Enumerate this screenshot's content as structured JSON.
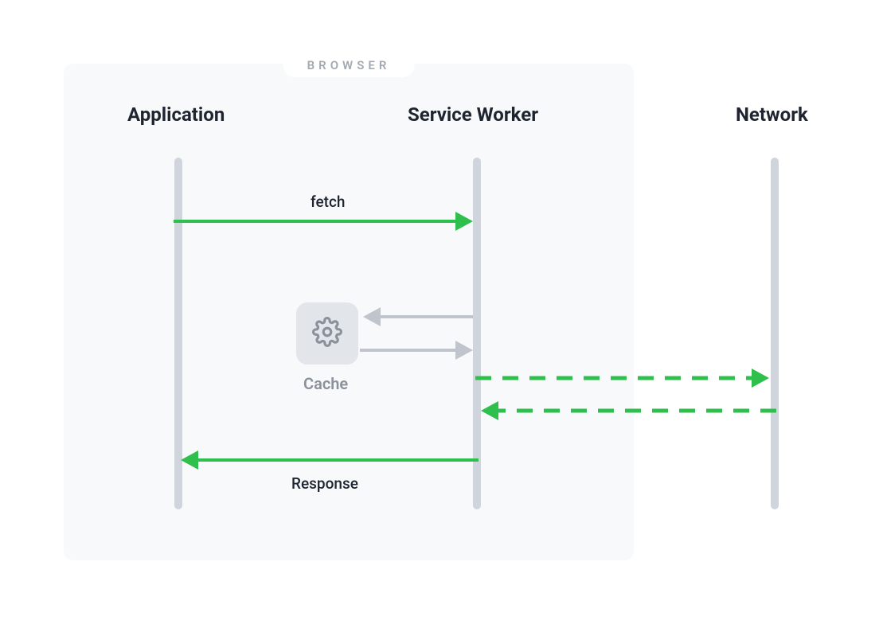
{
  "browserLabel": "BROWSER",
  "actors": {
    "application": "Application",
    "serviceWorker": "Service Worker",
    "network": "Network"
  },
  "cache": {
    "label": "Cache"
  },
  "messages": {
    "fetch": "fetch",
    "response": "Response"
  },
  "colors": {
    "accent": "#2fbf4d",
    "muted": "#c0c5cd",
    "dark": "#1e2530"
  },
  "positions": {
    "applicationX": 224,
    "serviceWorkerX": 599,
    "networkX": 973,
    "fetchY": 278,
    "cacheInY": 398,
    "cacheOutY": 440,
    "networkOutY": 475,
    "networkInY": 516,
    "responseY": 578
  }
}
